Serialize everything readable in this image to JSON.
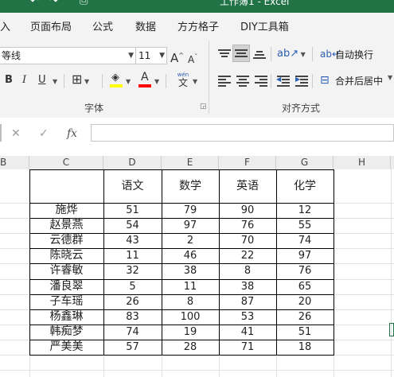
{
  "window": {
    "title": "工作簿1  -  Excel"
  },
  "tabs": [
    "入",
    "页面布局",
    "公式",
    "数据",
    "方方格子",
    "DIY工具箱"
  ],
  "ribbon": {
    "font_name": "等线",
    "font_size": "11",
    "font_group_label": "字体",
    "align_group_label": "对齐方式",
    "wrap_text_label": "自动换行",
    "merge_center_label": "合并后居中",
    "bold": "B",
    "italic": "I",
    "underline": "U",
    "grow_font": "A",
    "shrink_font": "A",
    "font_color_letter": "A",
    "wen_top": "wén",
    "wen_char": "文",
    "highlight_color": "#ffff00",
    "font_color": "#ff0000"
  },
  "formula_bar": {
    "cancel": "✕",
    "enter": "✓",
    "fx": "fx",
    "value": ""
  },
  "columns": [
    "B",
    "C",
    "D",
    "E",
    "F",
    "G",
    "H"
  ],
  "table": {
    "headers": [
      "",
      "语文",
      "数学",
      "英语",
      "化学"
    ],
    "rows": [
      [
        "施烨",
        "51",
        "79",
        "90",
        "12"
      ],
      [
        "赵景燕",
        "54",
        "97",
        "76",
        "55"
      ],
      [
        "云德群",
        "43",
        "2",
        "70",
        "74"
      ],
      [
        "陈晓云",
        "11",
        "46",
        "22",
        "97"
      ],
      [
        "许睿敏",
        "32",
        "38",
        "8",
        "76"
      ],
      [
        "潘良翠",
        "5",
        "11",
        "38",
        "65"
      ],
      [
        "子车瑶",
        "26",
        "8",
        "87",
        "20"
      ],
      [
        "杨鑫琳",
        "83",
        "100",
        "53",
        "26"
      ],
      [
        "韩痴梦",
        "74",
        "19",
        "41",
        "51"
      ],
      [
        "严美美",
        "57",
        "28",
        "71",
        "18"
      ]
    ]
  },
  "colors": {
    "excel_green": "#217346"
  }
}
